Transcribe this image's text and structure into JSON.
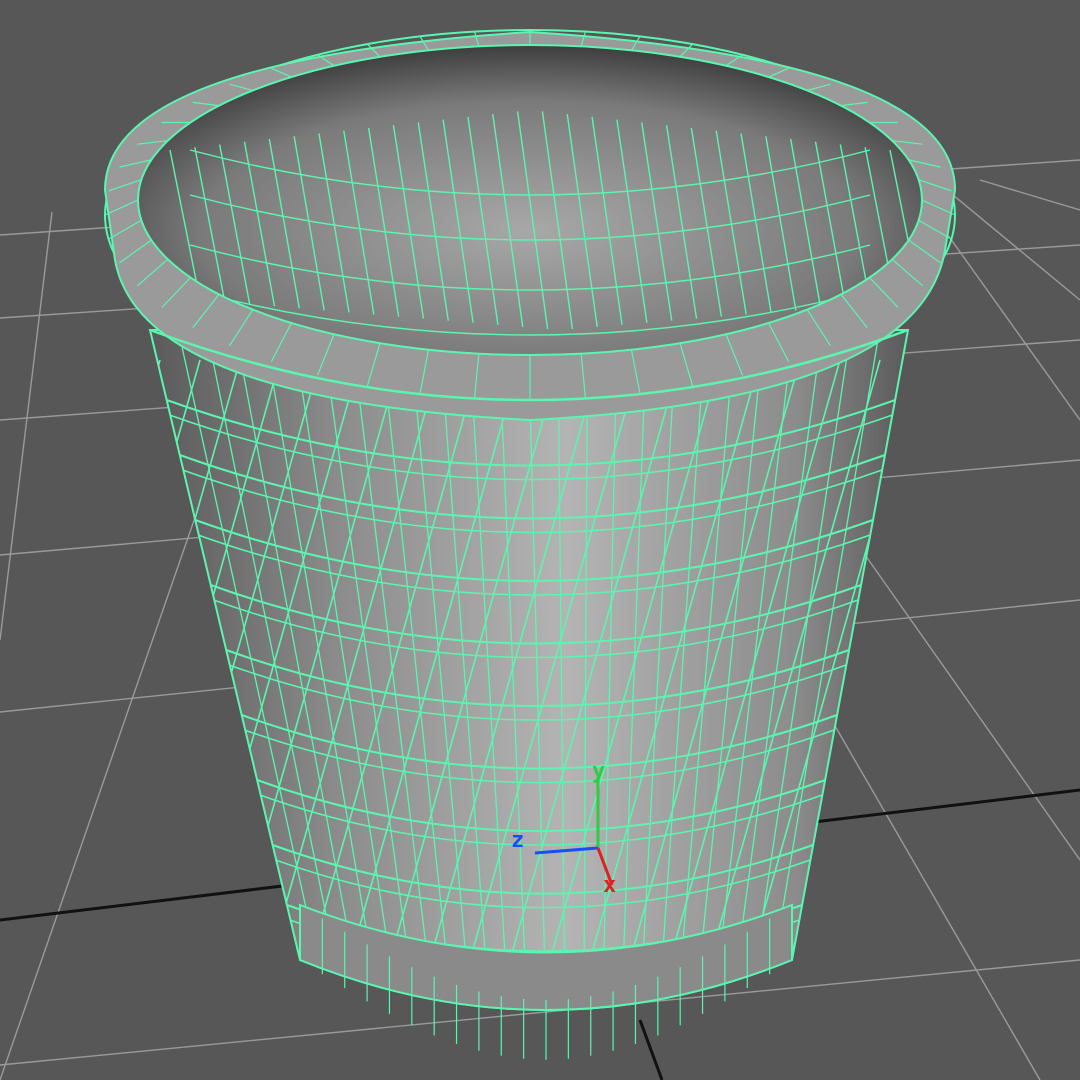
{
  "viewport": {
    "background": "#575757",
    "grid_color": "#9a9a9a",
    "grid_axis_color": "#111111",
    "wireframe_color": "#5cf5b0",
    "mesh_fill": "#8c8c8c",
    "mesh_fill_dark": "#5a5a5a",
    "mesh_fill_light": "#b4b4b4"
  },
  "model": {
    "object": "wastebasket",
    "icon": "mesh-wireframe-icon",
    "selected": true
  },
  "axis_gizmo": {
    "icon": "xyz-axis-gizmo-icon",
    "x": {
      "label": "x",
      "color": "#e02020"
    },
    "y": {
      "label": "y",
      "color": "#2ecc40"
    },
    "z": {
      "label": "z",
      "color": "#1a4cff"
    }
  }
}
